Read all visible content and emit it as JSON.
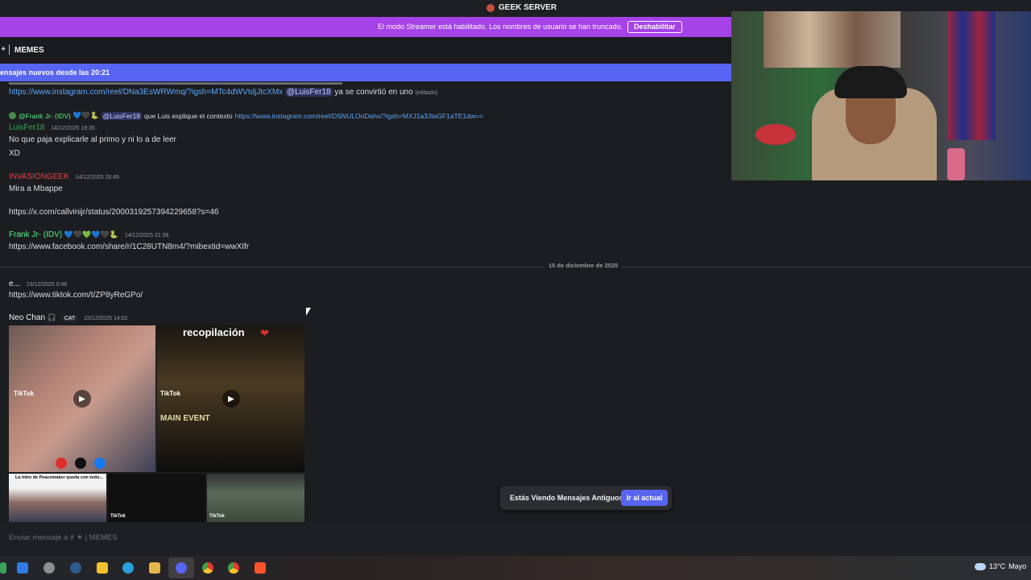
{
  "server": {
    "name": "GEEK SERVER"
  },
  "streamer_banner": {
    "text": "El modo Streamer está habilitado. Los nombres de usuario se han truncado.",
    "button": "Deshabilitar"
  },
  "channel": {
    "name": "MEMES"
  },
  "new_messages_banner": "ensajes nuevos desde las 20:21",
  "messages": {
    "m1": {
      "link": "https://www.instagram.com/reel/DNa3EsWRWmq/?igsh=MTc4dWVtdjJtcXMx",
      "mention": "@LuisFer18",
      "text": "ya se convirtió en uno",
      "edited": "(editado)"
    },
    "reply": {
      "author": "@Frank Jr- (IDV)",
      "mention": "@LuisFer18",
      "text": "que Luis explique el contexto",
      "link": "https://www.instagram.com/reel/DSNULOoDahx/?igsh=MXJ1a3JtaGF1aTE1dw=="
    },
    "m2": {
      "author": "LuisFer18",
      "timestamp": "14/12/2025 19:35",
      "line1": "No que paja explicarle al primo y ni lo a de leer",
      "line2": "XD"
    },
    "m3": {
      "author": "INVASIONGEEK",
      "timestamp": "14/12/2025 20:45",
      "text": "Mira a Mbappe",
      "link": "https://x.com/callvinijr/status/2000319257394229658?s=46"
    },
    "m4": {
      "author": "Frank Jr- (IDV)",
      "timestamp": "14/12/2025 21:39",
      "link": "https://www.facebook.com/share/r/1C28UTN8m4/?mibextid=wwXIfr"
    },
    "date_divider": "15 de diciembre de 2025",
    "m5": {
      "author": "e...",
      "timestamp": "15/12/2025 0:46",
      "link": "https://www.tiktok.com/t/ZP8yReGPo/"
    },
    "m6": {
      "author": "Neo Chan",
      "tag": "CAT",
      "timestamp": "15/12/2025 14:02",
      "tiles": {
        "t2_title": "recopilación",
        "t2_event": "MAIN EVENT",
        "t3_caption": "La intro de Peacemaker queda con todo..."
      },
      "tiktok": "TikTok"
    }
  },
  "old_messages": {
    "text": "Estás Viendo Mensajes Antiguos",
    "button": "Ir al actual"
  },
  "composer": {
    "placeholder": "Enviar mensaje a #",
    "channel": "MEMES"
  },
  "tray": {
    "temperature": "13°C",
    "weather": "Mayo"
  },
  "colors": {
    "accent": "#5865f2",
    "streamer": "#a542e8",
    "luisfer": "#3ba55c",
    "invasion": "#ed4245",
    "frank": "#57f287",
    "link": "#5aa7ff"
  }
}
